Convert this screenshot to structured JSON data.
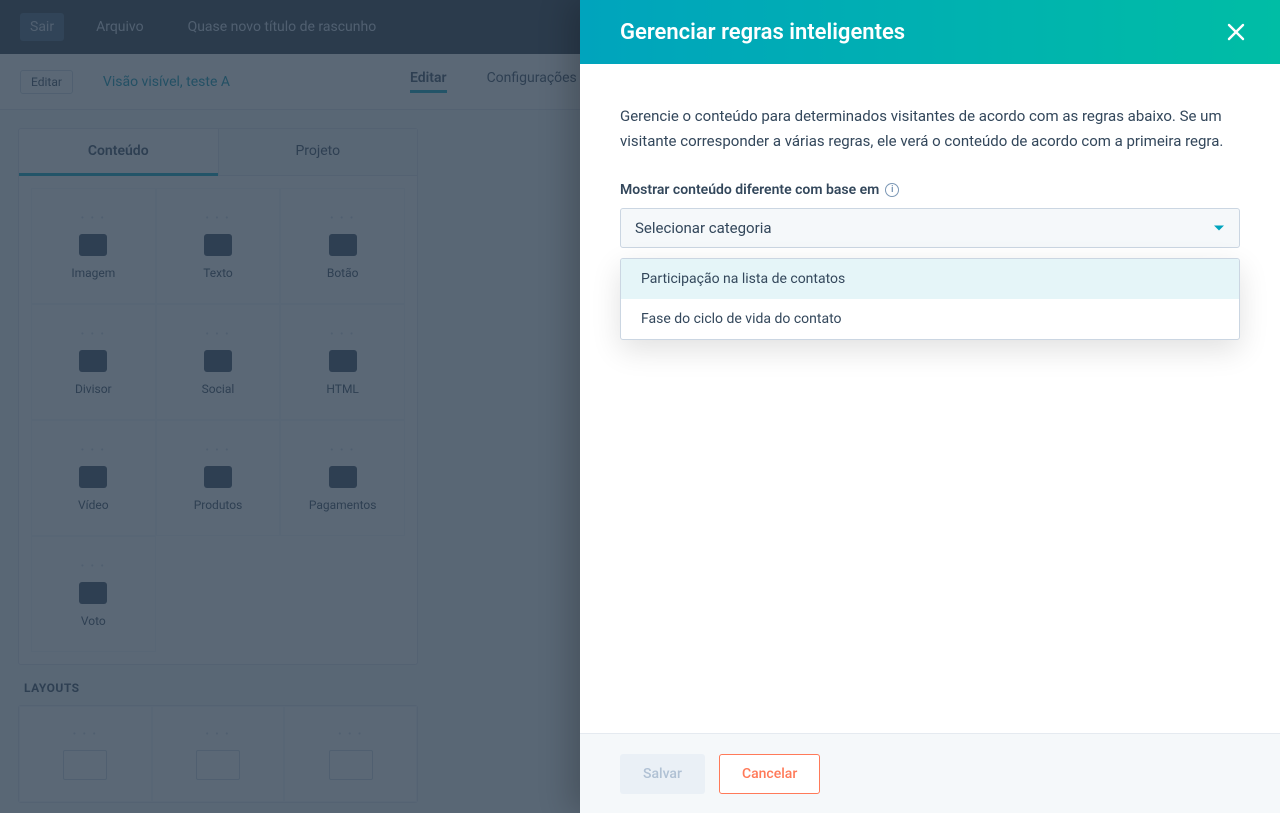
{
  "bg": {
    "top": {
      "exit": "Sair",
      "file": "Arquivo",
      "title": "Quase novo título de rascunho"
    },
    "sub": {
      "toggle": "Editar",
      "link": "Visão visível, teste A",
      "tab_edit": "Editar",
      "tab_settings": "Configurações"
    },
    "left": {
      "tab_content": "Conteúdo",
      "tab_design": "Projeto",
      "items": [
        {
          "label": "Imagem"
        },
        {
          "label": "Texto"
        },
        {
          "label": "Botão"
        },
        {
          "label": "Divisor"
        },
        {
          "label": "Social"
        },
        {
          "label": "HTML"
        },
        {
          "label": "Vídeo"
        },
        {
          "label": "Produtos"
        },
        {
          "label": "Pagamentos"
        },
        {
          "label": "Voto"
        }
      ],
      "section": "LAYOUTS"
    }
  },
  "panel": {
    "title": "Gerenciar regras inteligentes",
    "description": "Gerencie o conteúdo para determinados visitantes de acordo com as regras abaixo. Se um visitante corresponder a várias regras, ele verá o conteúdo de acordo com a primeira regra.",
    "field_label": "Mostrar conteúdo diferente com base em",
    "select_placeholder": "Selecionar categoria",
    "options": [
      "Participação na lista de contatos",
      "Fase do ciclo de vida do contato"
    ],
    "save": "Salvar",
    "cancel": "Cancelar"
  }
}
